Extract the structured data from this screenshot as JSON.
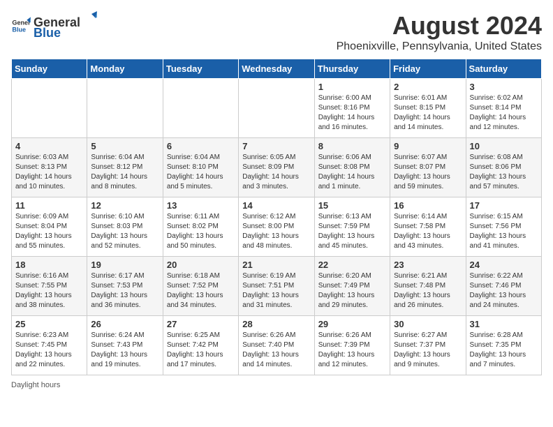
{
  "logo": {
    "general": "General",
    "blue": "Blue"
  },
  "title": "August 2024",
  "subtitle": "Phoenixville, Pennsylvania, United States",
  "days_of_week": [
    "Sunday",
    "Monday",
    "Tuesday",
    "Wednesday",
    "Thursday",
    "Friday",
    "Saturday"
  ],
  "weeks": [
    [
      {
        "day": "",
        "info": ""
      },
      {
        "day": "",
        "info": ""
      },
      {
        "day": "",
        "info": ""
      },
      {
        "day": "",
        "info": ""
      },
      {
        "day": "1",
        "info": "Sunrise: 6:00 AM\nSunset: 8:16 PM\nDaylight: 14 hours and 16 minutes."
      },
      {
        "day": "2",
        "info": "Sunrise: 6:01 AM\nSunset: 8:15 PM\nDaylight: 14 hours and 14 minutes."
      },
      {
        "day": "3",
        "info": "Sunrise: 6:02 AM\nSunset: 8:14 PM\nDaylight: 14 hours and 12 minutes."
      }
    ],
    [
      {
        "day": "4",
        "info": "Sunrise: 6:03 AM\nSunset: 8:13 PM\nDaylight: 14 hours and 10 minutes."
      },
      {
        "day": "5",
        "info": "Sunrise: 6:04 AM\nSunset: 8:12 PM\nDaylight: 14 hours and 8 minutes."
      },
      {
        "day": "6",
        "info": "Sunrise: 6:04 AM\nSunset: 8:10 PM\nDaylight: 14 hours and 5 minutes."
      },
      {
        "day": "7",
        "info": "Sunrise: 6:05 AM\nSunset: 8:09 PM\nDaylight: 14 hours and 3 minutes."
      },
      {
        "day": "8",
        "info": "Sunrise: 6:06 AM\nSunset: 8:08 PM\nDaylight: 14 hours and 1 minute."
      },
      {
        "day": "9",
        "info": "Sunrise: 6:07 AM\nSunset: 8:07 PM\nDaylight: 13 hours and 59 minutes."
      },
      {
        "day": "10",
        "info": "Sunrise: 6:08 AM\nSunset: 8:06 PM\nDaylight: 13 hours and 57 minutes."
      }
    ],
    [
      {
        "day": "11",
        "info": "Sunrise: 6:09 AM\nSunset: 8:04 PM\nDaylight: 13 hours and 55 minutes."
      },
      {
        "day": "12",
        "info": "Sunrise: 6:10 AM\nSunset: 8:03 PM\nDaylight: 13 hours and 52 minutes."
      },
      {
        "day": "13",
        "info": "Sunrise: 6:11 AM\nSunset: 8:02 PM\nDaylight: 13 hours and 50 minutes."
      },
      {
        "day": "14",
        "info": "Sunrise: 6:12 AM\nSunset: 8:00 PM\nDaylight: 13 hours and 48 minutes."
      },
      {
        "day": "15",
        "info": "Sunrise: 6:13 AM\nSunset: 7:59 PM\nDaylight: 13 hours and 45 minutes."
      },
      {
        "day": "16",
        "info": "Sunrise: 6:14 AM\nSunset: 7:58 PM\nDaylight: 13 hours and 43 minutes."
      },
      {
        "day": "17",
        "info": "Sunrise: 6:15 AM\nSunset: 7:56 PM\nDaylight: 13 hours and 41 minutes."
      }
    ],
    [
      {
        "day": "18",
        "info": "Sunrise: 6:16 AM\nSunset: 7:55 PM\nDaylight: 13 hours and 38 minutes."
      },
      {
        "day": "19",
        "info": "Sunrise: 6:17 AM\nSunset: 7:53 PM\nDaylight: 13 hours and 36 minutes."
      },
      {
        "day": "20",
        "info": "Sunrise: 6:18 AM\nSunset: 7:52 PM\nDaylight: 13 hours and 34 minutes."
      },
      {
        "day": "21",
        "info": "Sunrise: 6:19 AM\nSunset: 7:51 PM\nDaylight: 13 hours and 31 minutes."
      },
      {
        "day": "22",
        "info": "Sunrise: 6:20 AM\nSunset: 7:49 PM\nDaylight: 13 hours and 29 minutes."
      },
      {
        "day": "23",
        "info": "Sunrise: 6:21 AM\nSunset: 7:48 PM\nDaylight: 13 hours and 26 minutes."
      },
      {
        "day": "24",
        "info": "Sunrise: 6:22 AM\nSunset: 7:46 PM\nDaylight: 13 hours and 24 minutes."
      }
    ],
    [
      {
        "day": "25",
        "info": "Sunrise: 6:23 AM\nSunset: 7:45 PM\nDaylight: 13 hours and 22 minutes."
      },
      {
        "day": "26",
        "info": "Sunrise: 6:24 AM\nSunset: 7:43 PM\nDaylight: 13 hours and 19 minutes."
      },
      {
        "day": "27",
        "info": "Sunrise: 6:25 AM\nSunset: 7:42 PM\nDaylight: 13 hours and 17 minutes."
      },
      {
        "day": "28",
        "info": "Sunrise: 6:26 AM\nSunset: 7:40 PM\nDaylight: 13 hours and 14 minutes."
      },
      {
        "day": "29",
        "info": "Sunrise: 6:26 AM\nSunset: 7:39 PM\nDaylight: 13 hours and 12 minutes."
      },
      {
        "day": "30",
        "info": "Sunrise: 6:27 AM\nSunset: 7:37 PM\nDaylight: 13 hours and 9 minutes."
      },
      {
        "day": "31",
        "info": "Sunrise: 6:28 AM\nSunset: 7:35 PM\nDaylight: 13 hours and 7 minutes."
      }
    ]
  ],
  "footer": "Daylight hours"
}
